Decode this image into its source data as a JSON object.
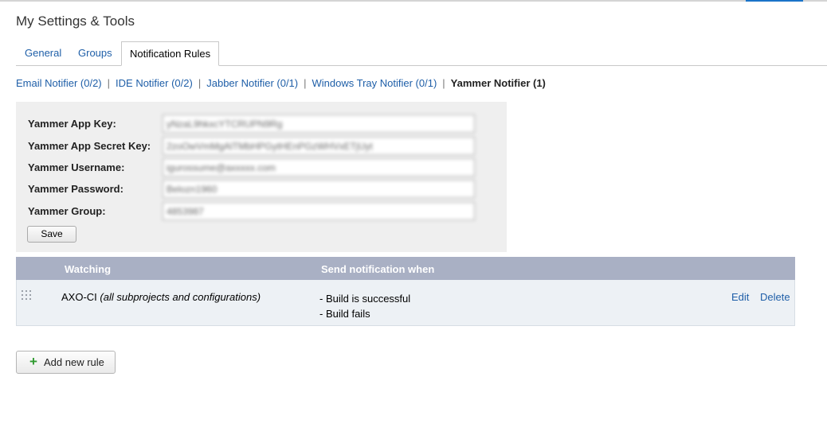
{
  "page": {
    "title": "My Settings & Tools"
  },
  "tabs": [
    {
      "label": "General",
      "active": false
    },
    {
      "label": "Groups",
      "active": false
    },
    {
      "label": "Notification Rules",
      "active": true
    }
  ],
  "notifiers": [
    {
      "label": "Email Notifier (0/2)",
      "current": false
    },
    {
      "label": "IDE Notifier (0/2)",
      "current": false
    },
    {
      "label": "Jabber Notifier (0/1)",
      "current": false
    },
    {
      "label": "Windows Tray Notifier (0/1)",
      "current": false
    },
    {
      "label": "Yammer Notifier (1)",
      "current": true
    }
  ],
  "separator": "|",
  "form": {
    "fields": [
      {
        "label": "Yammer App Key:",
        "value": "yNzaL9hkxcYTCRUPN9Rg"
      },
      {
        "label": "Yammer App Secret Key:",
        "value": "2zoOwVmMgAlTMbHPGytHEnPGzWHVxETjUyt"
      },
      {
        "label": "Yammer Username:",
        "value": "igurossume@axxxxx.com"
      },
      {
        "label": "Yammer Password:",
        "value": "Belozn1960"
      },
      {
        "label": "Yammer Group:",
        "value": "4853987"
      }
    ],
    "save_label": "Save"
  },
  "rules": {
    "headers": {
      "watching": "Watching",
      "send_when": "Send notification when"
    },
    "rows": [
      {
        "project": "AXO-CI",
        "scope": "(all subprojects and configurations)",
        "events": [
          "- Build is successful",
          "- Build fails"
        ],
        "edit_label": "Edit",
        "delete_label": "Delete"
      }
    ]
  },
  "add_rule": {
    "label": "Add new rule",
    "icon": "plus-icon",
    "icon_glyph": "+"
  },
  "colors": {
    "link": "#1f5fa8",
    "table_header": "#a9b0c4",
    "row_background": "#edf1f5",
    "panel_background": "#efefef",
    "add_icon": "#2f9a2f"
  }
}
